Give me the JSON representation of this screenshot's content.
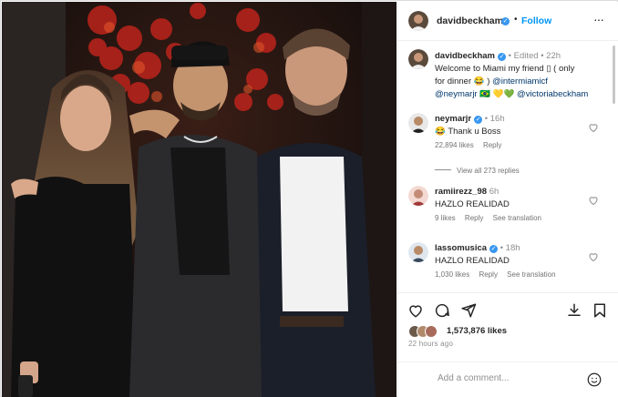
{
  "post": {
    "author": "davidbeckham",
    "follow_label": "Follow",
    "dot": "•",
    "more_label": "···"
  },
  "caption": {
    "username": "davidbeckham",
    "edited": "Edited",
    "age": "22h",
    "text_line1": "Welcome to Miami my friend ",
    "box_glyph": "▯",
    "text_line1b": " ( only",
    "text_line2a": "for dinner ",
    "laugh_emoji": "😂",
    "text_line2b": " ) ",
    "mention1": "@intermiamicf",
    "mention2": "@neymarjr",
    "flag": "🇧🇷",
    "hearts": "💛💚",
    "mention3": "@victoriabeckham"
  },
  "comments": [
    {
      "username": "neymarjr",
      "verified": true,
      "age": "16h",
      "text": "Thank u Boss",
      "emoji": "😂",
      "likes": "22,894 likes",
      "reply": "Reply",
      "translate": ""
    },
    {
      "username": "ramiirezz_98",
      "verified": false,
      "age": "6h",
      "text": "HAZLO REALIDAD",
      "emoji": "",
      "likes": "9 likes",
      "reply": "Reply",
      "translate": "See translation"
    },
    {
      "username": "lassomusica",
      "verified": true,
      "age": "18h",
      "text": "HAZLO REALIDAD",
      "emoji": "",
      "likes": "1,030 likes",
      "reply": "Reply",
      "translate": "See translation"
    }
  ],
  "view_replies": "View all 273 replies",
  "likes_total": "1,573,876 likes",
  "time_ago": "22 hours ago",
  "add_comment_placeholder": "Add a comment...",
  "icons": [
    "heart-icon",
    "comment-icon",
    "share-icon",
    "save-icon",
    "emoji-icon",
    "more-icon",
    "verified-icon"
  ],
  "colors": {
    "link": "#00376b",
    "follow": "#0095f6",
    "verified": "#3897f0",
    "muted": "#737373"
  }
}
